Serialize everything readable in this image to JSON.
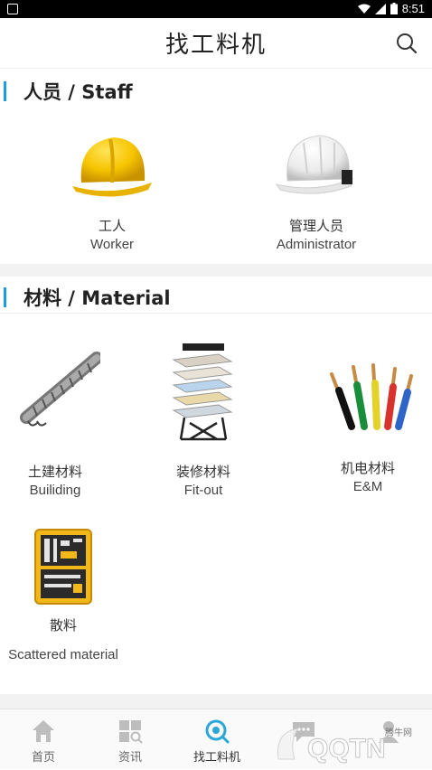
{
  "status_bar": {
    "time": "8:51"
  },
  "app_bar": {
    "title": "找工料机",
    "search_icon": "search-icon"
  },
  "staff_section": {
    "title": "人员 / Staff",
    "items": [
      {
        "cn": "工人",
        "en": "Worker",
        "icon": "yellow-helmet"
      },
      {
        "cn": "管理人员",
        "en": "Administrator",
        "icon": "white-helmet"
      }
    ]
  },
  "material_section": {
    "title": "材料 / Material",
    "items": [
      {
        "cn": "土建材料",
        "en": "Builiding",
        "icon": "rebar-cage"
      },
      {
        "cn": "装修材料",
        "en": "Fit-out",
        "icon": "tile-display-rack"
      },
      {
        "cn": "机电材料",
        "en": "E&M",
        "icon": "electric-wires"
      },
      {
        "cn": "散料",
        "en": "Scattered material",
        "icon": "toolbox"
      }
    ]
  },
  "bottom_nav": [
    {
      "label": "首页",
      "icon": "home-icon"
    },
    {
      "label": "资讯",
      "icon": "news-icon"
    },
    {
      "label": "找工料机",
      "icon": "find-icon",
      "active": true
    },
    {
      "label": "",
      "icon": "chat-icon"
    },
    {
      "label": "",
      "icon": "profile-icon"
    }
  ],
  "watermark": {
    "text": "QQTN",
    "sub": "腾牛网"
  },
  "colors": {
    "accent": "#1b9ce5",
    "active_nav": "#2aa6d8"
  }
}
